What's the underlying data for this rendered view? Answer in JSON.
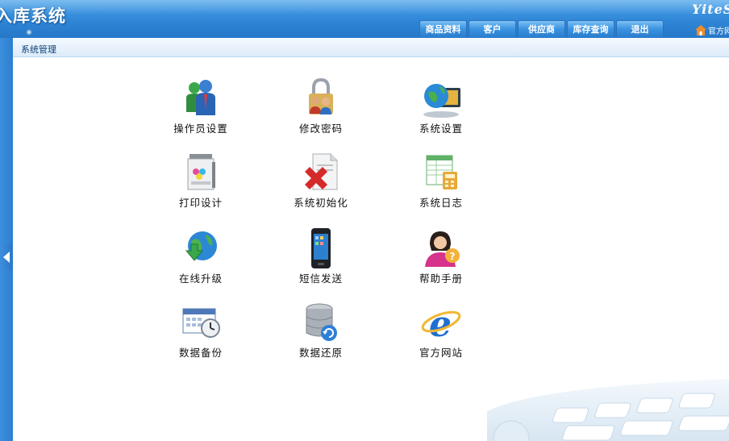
{
  "header": {
    "app_title": "入库系统",
    "brand": "YiteS",
    "nav_tabs": [
      "商品资料",
      "客户",
      "供应商",
      "库存查询",
      "退出"
    ],
    "home_link": "官方网"
  },
  "breadcrumb": "系统管理",
  "modules": [
    {
      "label": "操作员设置",
      "icon": "operator-users-icon"
    },
    {
      "label": "修改密码",
      "icon": "lock-users-icon"
    },
    {
      "label": "系统设置",
      "icon": "globe-monitor-icon"
    },
    {
      "label": "打印设计",
      "icon": "printer-icon"
    },
    {
      "label": "系统初始化",
      "icon": "document-delete-icon"
    },
    {
      "label": "系统日志",
      "icon": "spreadsheet-calculator-icon"
    },
    {
      "label": "在线升级",
      "icon": "globe-download-icon"
    },
    {
      "label": "短信发送",
      "icon": "mobile-phone-icon"
    },
    {
      "label": "帮助手册",
      "icon": "help-person-icon"
    },
    {
      "label": "数据备份",
      "icon": "calendar-clock-icon"
    },
    {
      "label": "数据还原",
      "icon": "database-restore-icon"
    },
    {
      "label": "官方网站",
      "icon": "internet-explorer-icon"
    }
  ],
  "colors": {
    "banner": "#2f86d6",
    "tab": "#3a93e0",
    "crumb_text": "#0d3f7a"
  }
}
